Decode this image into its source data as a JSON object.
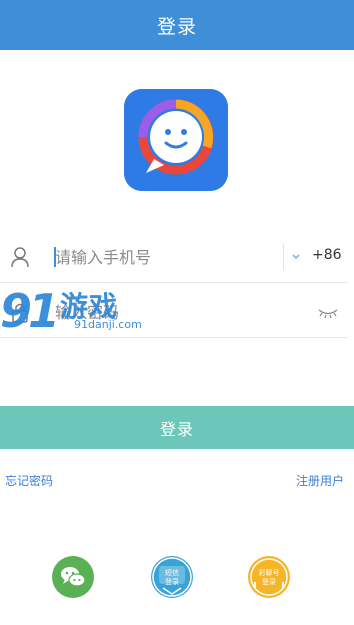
{
  "header": {
    "title": "登录"
  },
  "form": {
    "phone_placeholder": "请输入手机号",
    "country_code": "+86",
    "password_placeholder": "输入密码"
  },
  "buttons": {
    "login_label": "登录"
  },
  "links": {
    "forgot_password": "忘记密码",
    "register": "注册用户"
  },
  "social": {
    "sms_label_line1": "短信",
    "sms_label_line2": "登录",
    "caiyou_label_line1": "彩聊号",
    "caiyou_label_line2": "登录"
  },
  "watermark": {
    "title": "游戏",
    "domain": "91danji.com"
  },
  "colors": {
    "header": "#3f8fd8",
    "login_button": "#6cc6ba",
    "link": "#3b7fd2",
    "wechat": "#5ab055",
    "sms": "#3aa3d6",
    "caiyou": "#f5b526"
  }
}
